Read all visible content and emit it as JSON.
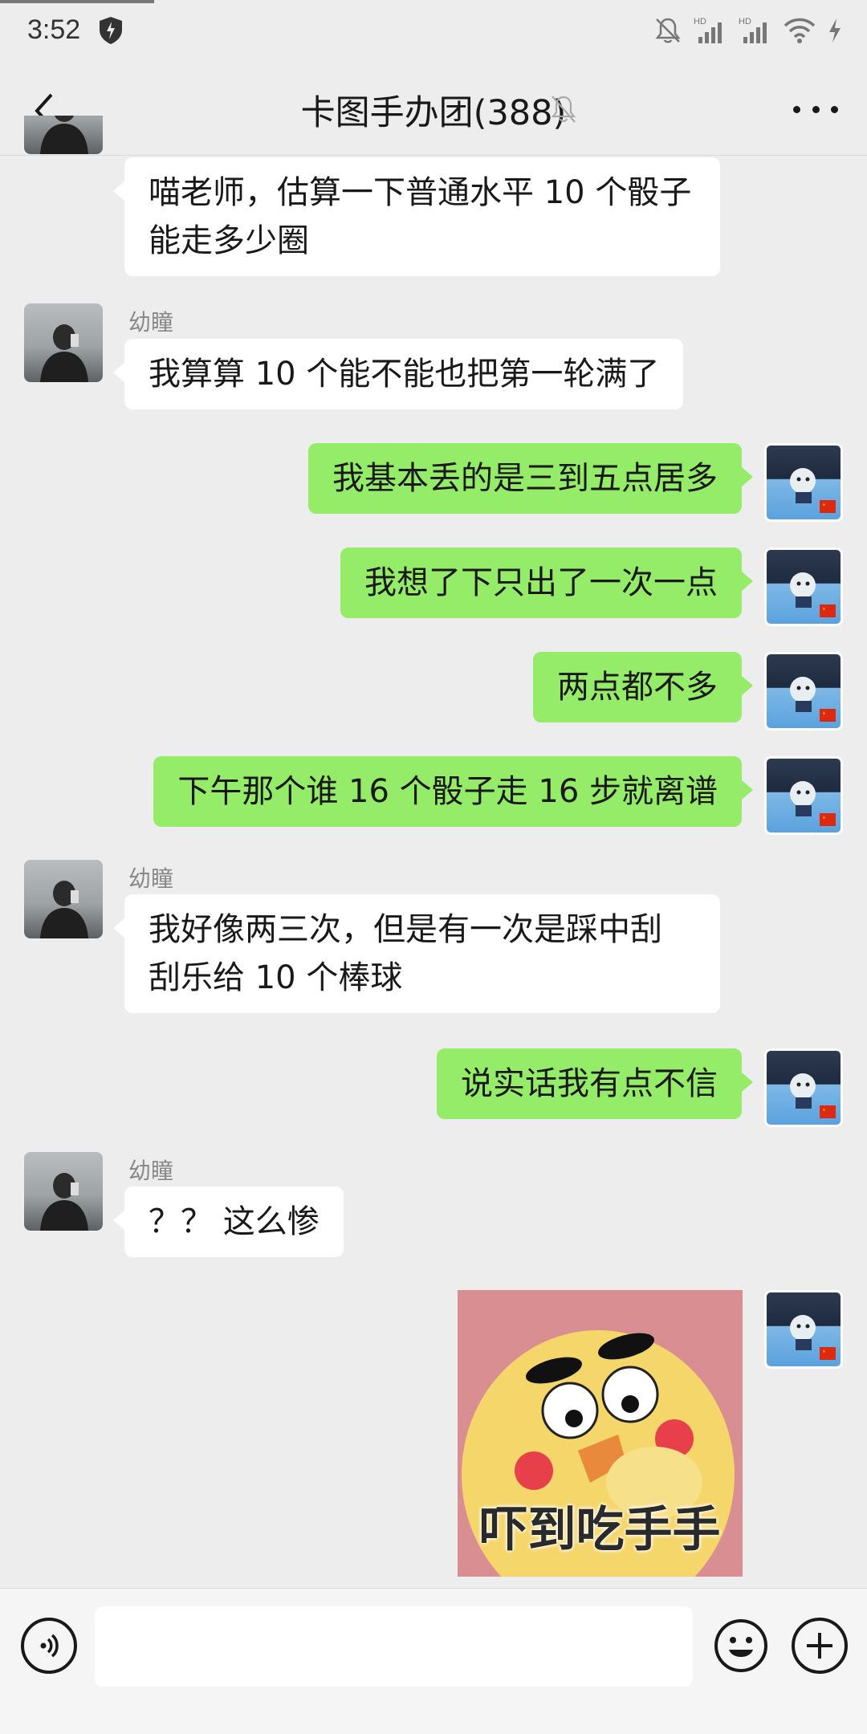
{
  "status_bar": {
    "time": "3:52",
    "icons": [
      "shield-icon",
      "mute-bell-icon",
      "hd-signal-icon",
      "hd-signal-icon",
      "wifi-icon",
      "charging-icon"
    ]
  },
  "header": {
    "title": "卡图手办团(388)",
    "back_icon": "chevron-left-icon",
    "mute_icon": "muted-bell-icon",
    "more_icon": "more-dots-icon"
  },
  "messages": [
    {
      "direction": "in",
      "sender": "",
      "text_lines": [
        "喵老师，估算一下普通水平 10 个骰子",
        "能走多少圈"
      ]
    },
    {
      "direction": "in",
      "sender": "幼瞳",
      "text": "我算算 10 个能不能也把第一轮满了"
    },
    {
      "direction": "out",
      "text": "我基本丢的是三到五点居多"
    },
    {
      "direction": "out",
      "text": "我想了下只出了一次一点"
    },
    {
      "direction": "out",
      "text": "两点都不多"
    },
    {
      "direction": "out",
      "text": "下午那个谁 16 个骰子走 16 步就离谱"
    },
    {
      "direction": "in",
      "sender": "幼瞳",
      "text_lines": [
        "我好像两三次，但是有一次是踩中刮",
        "刮乐给 10 个棒球"
      ]
    },
    {
      "direction": "out",
      "text": "说实话我有点不信"
    },
    {
      "direction": "in",
      "sender": "幼瞳",
      "text": "？？ 这么惨"
    },
    {
      "direction": "out",
      "type": "sticker",
      "caption": "吓到吃手手"
    }
  ],
  "input_bar": {
    "placeholder": "",
    "voice_icon": "voice-icon",
    "emoji_icon": "emoji-icon",
    "plus_icon": "plus-icon"
  },
  "colors": {
    "background": "#ededed",
    "outgoing_bubble": "#95ec69",
    "incoming_bubble": "#ffffff"
  }
}
